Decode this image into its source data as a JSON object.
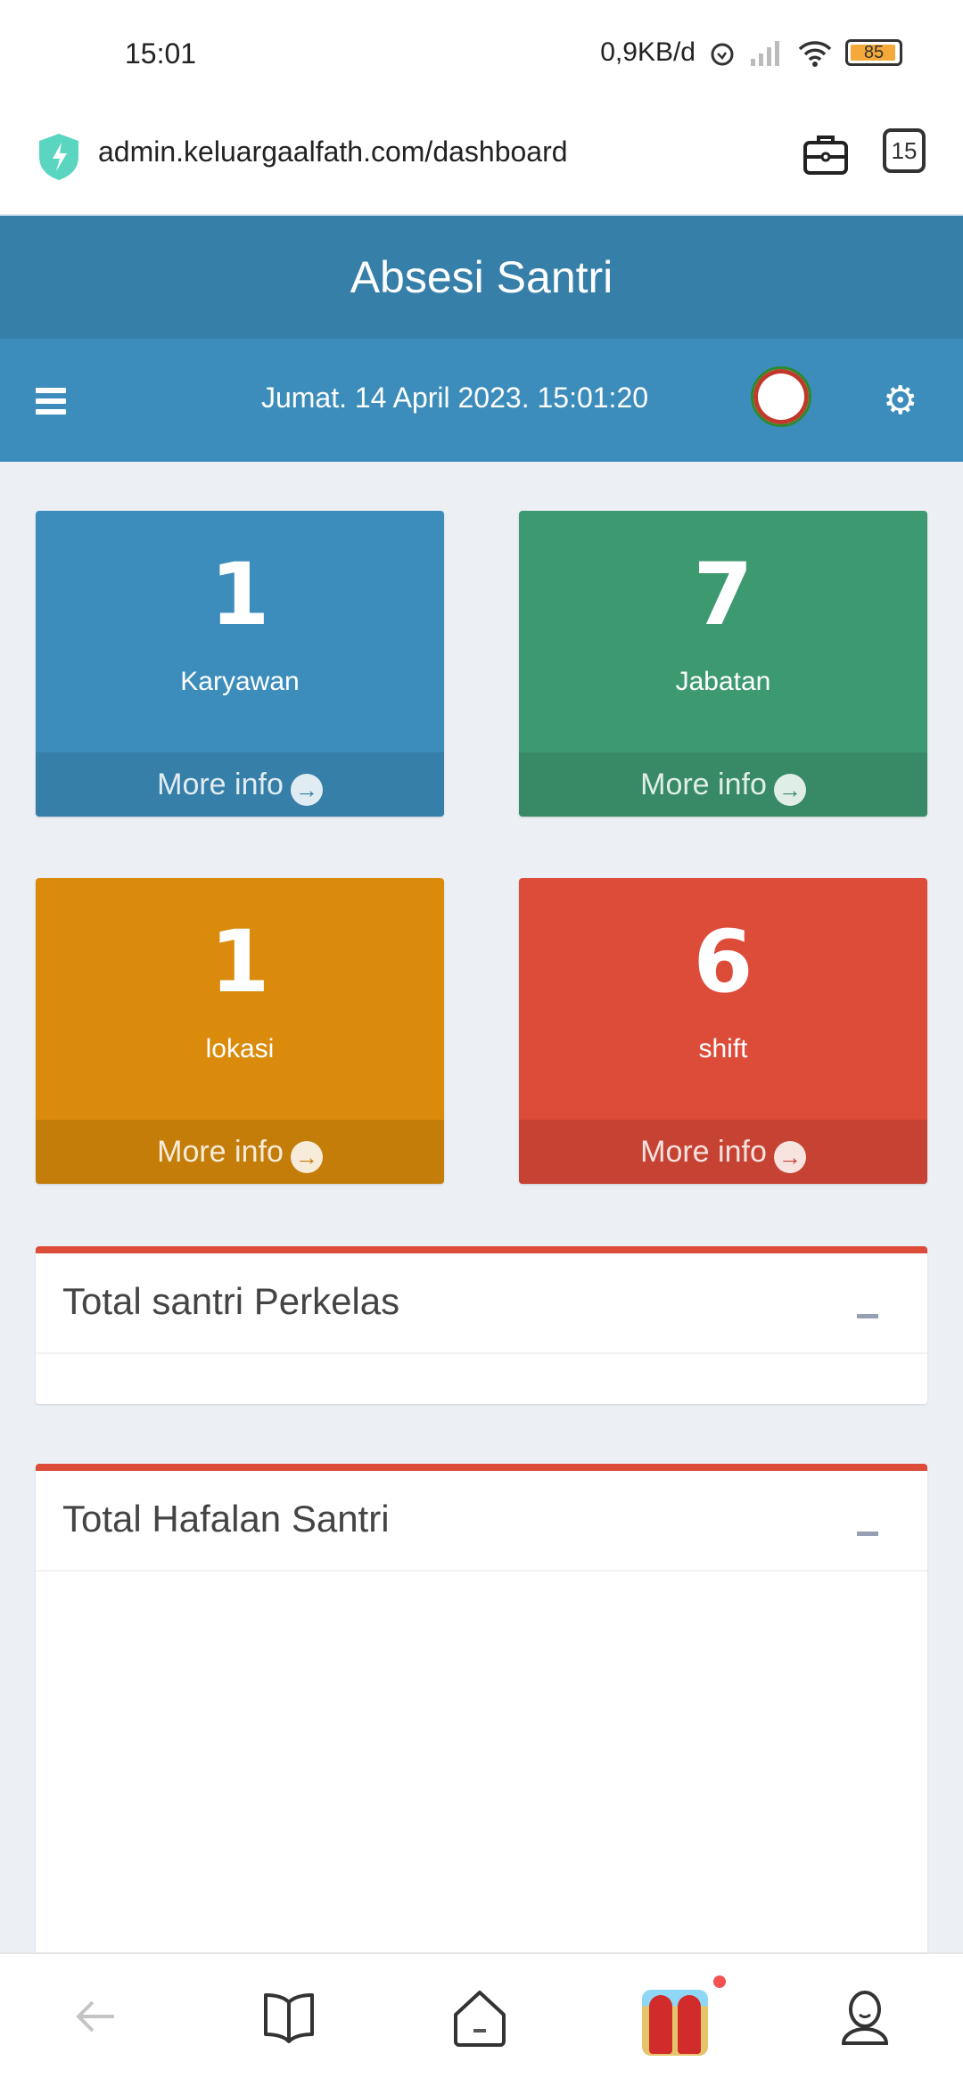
{
  "status_bar": {
    "time": "15:01",
    "network_speed": "0,9KB/d",
    "battery": "85",
    "icons": [
      "alarm-icon",
      "signal-icon",
      "wifi-icon",
      "battery-icon"
    ]
  },
  "browser": {
    "url": "admin.keluargaalfath.com/dashboard",
    "tab_count": "15",
    "icons": [
      "shield-bolt-icon",
      "briefcase-icon",
      "tabs-icon"
    ]
  },
  "header": {
    "app_title": "Absesi Santri",
    "datetime": "Jumat. 14 April 2023. 15:01:20",
    "icons": [
      "menu-icon",
      "logo-seal",
      "gears-icon"
    ]
  },
  "stats": [
    {
      "value": "1",
      "label": "Karyawan",
      "more": "More info",
      "color": "#3c8dbc"
    },
    {
      "value": "7",
      "label": "Jabatan",
      "more": "More info",
      "color": "#3d9970"
    },
    {
      "value": "1",
      "label": "lokasi",
      "more": "More info",
      "color": "#db8b0b"
    },
    {
      "value": "6",
      "label": "shift",
      "more": "More info",
      "color": "#dd4b39"
    }
  ],
  "panels": [
    {
      "title": "Total santri Perkelas"
    },
    {
      "title": "Total Hafalan Santri"
    }
  ],
  "bottom_nav": {
    "icons": [
      "back-icon",
      "bookmarks-icon",
      "home-icon",
      "game-app-icon",
      "profile-icon"
    ]
  }
}
